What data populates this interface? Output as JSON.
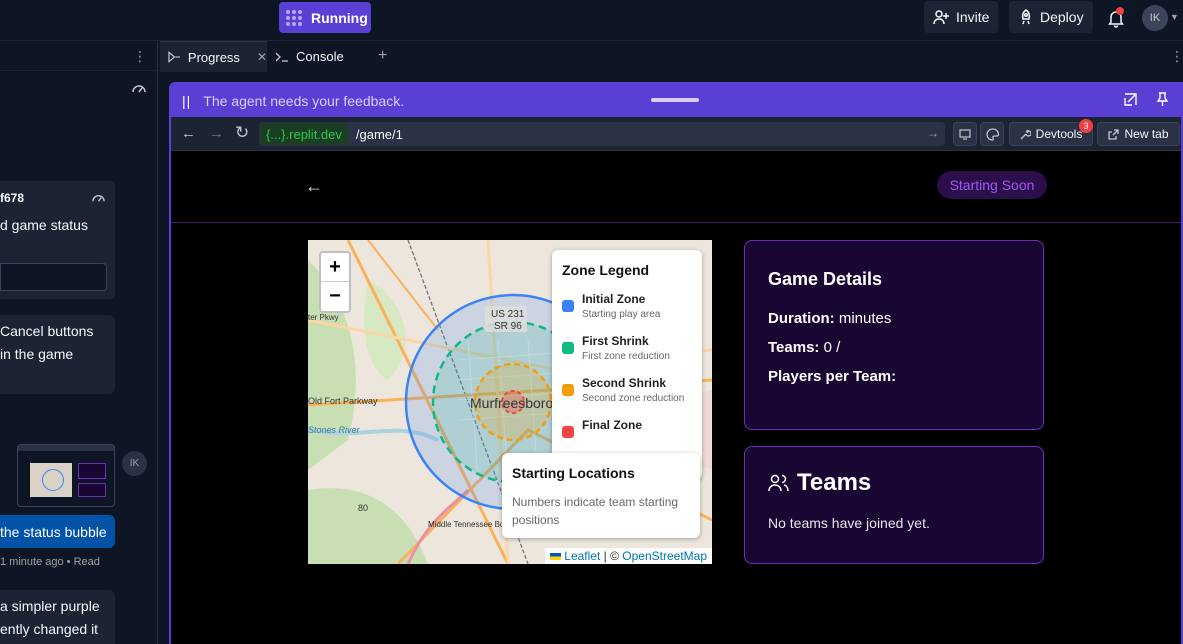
{
  "topbar": {
    "status_label": "Running",
    "invite_label": "Invite",
    "deploy_label": "Deploy",
    "avatar_initials": "IK",
    "notification_color": "#f23f42",
    "accent_color": "#5a3fd4"
  },
  "left_panel": {
    "card1_line1": "f678",
    "card1_line2": "d game status",
    "card2_line1": "Cancel buttons",
    "card2_line2": " in the game",
    "avatar_initials": "IK",
    "user_message": "the status bubble",
    "meta_time": "1 minute ago",
    "meta_read": "Read",
    "card3_line1": "a simpler purple",
    "card3_line2": "ently changed it"
  },
  "tabs": [
    {
      "label": "Progress",
      "icon": "progress-icon",
      "active": true
    },
    {
      "label": "Console",
      "icon": "console-icon",
      "active": false
    }
  ],
  "webview": {
    "feedback_text": "The agent needs your feedback.",
    "url_host": "{...}.replit.dev",
    "url_path": "/game/1",
    "devtools_label": "Devtools",
    "devtools_badge": "3",
    "newtab_label": "New tab"
  },
  "app": {
    "status_pill": "Starting Soon",
    "map": {
      "zoom_in": "+",
      "zoom_out": "−",
      "labels": {
        "route": "US 231",
        "route2": "SR 96",
        "city": "Murfreesboro",
        "road1": "Old Fort Parkway",
        "road2": "Stones River",
        "road3": "Middle Tennessee Boulevard",
        "road4": "ter Pkwy",
        "road5": "80"
      },
      "legend_title": "Zone Legend",
      "legend": [
        {
          "name": "Initial Zone",
          "desc": "Starting play area",
          "color": "#3b82f6"
        },
        {
          "name": "First Shrink",
          "desc": "First zone reduction",
          "color": "#10b981"
        },
        {
          "name": "Second Shrink",
          "desc": "Second zone reduction",
          "color": "#f59e0b"
        },
        {
          "name": "Final Zone",
          "desc": "",
          "color": "#ef4444"
        }
      ],
      "starting_title": "Starting Locations",
      "starting_desc": "Numbers indicate team starting positions",
      "attrib_leaflet": "Leaflet",
      "attrib_sep": " | © ",
      "attrib_osm": "OpenStreetMap"
    },
    "details": {
      "title": "Game Details",
      "duration_label": "Duration:",
      "duration_value": " minutes",
      "teams_label": "Teams:",
      "teams_value": " 0 /",
      "ppt_label": "Players per Team:",
      "ppt_value": ""
    },
    "teams": {
      "title": "Teams",
      "empty": "No teams have joined yet."
    }
  }
}
